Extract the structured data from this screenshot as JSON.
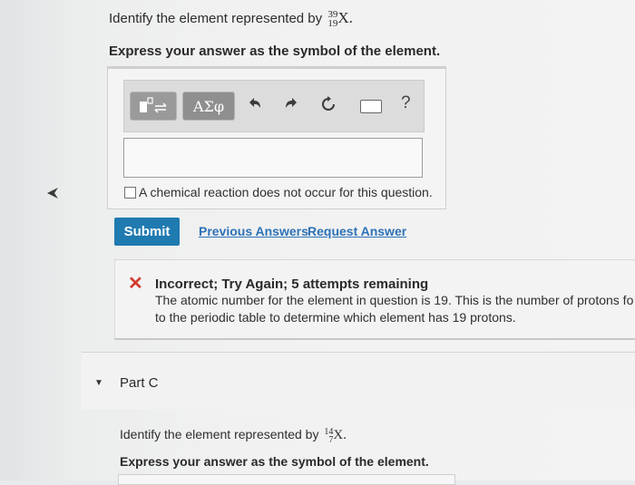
{
  "question_b": {
    "prefix": "Identify the element represented by",
    "mass_number": "39",
    "atomic_number": "19",
    "symbol": "X",
    "suffix": ".",
    "instruction": "Express your answer as the symbol of the element."
  },
  "toolbar": {
    "templates_icon": "templates-icon",
    "greek_label": "ΑΣφ",
    "undo_icon": "undo-icon",
    "redo_icon": "redo-icon",
    "reset_icon": "reset-icon",
    "keyboard_icon": "keyboard-icon",
    "help_label": "?"
  },
  "answer": {
    "value": ""
  },
  "no_reaction": {
    "label": "A chemical reaction does not occur for this question.",
    "checked": false
  },
  "actions": {
    "submit_label": "Submit",
    "previous_answers_label": "Previous Answers",
    "request_answer_label": "Request Answer"
  },
  "feedback": {
    "icon": "✕",
    "title": "Incorrect; Try Again; 5 attempts remaining",
    "line1": "The atomic number for the element in question is 19. This is the number of protons fo",
    "line2": "to the periodic table to determine which element has 19 protons."
  },
  "part_c": {
    "label": "Part C",
    "prefix": "Identify the element represented by",
    "mass_number": "14",
    "atomic_number": "7",
    "symbol": "X",
    "suffix": ".",
    "instruction": "Express your answer as the symbol of the element."
  },
  "colors": {
    "submit": "#1f7ab0",
    "link": "#2d72b7",
    "error": "#d43a2f"
  }
}
